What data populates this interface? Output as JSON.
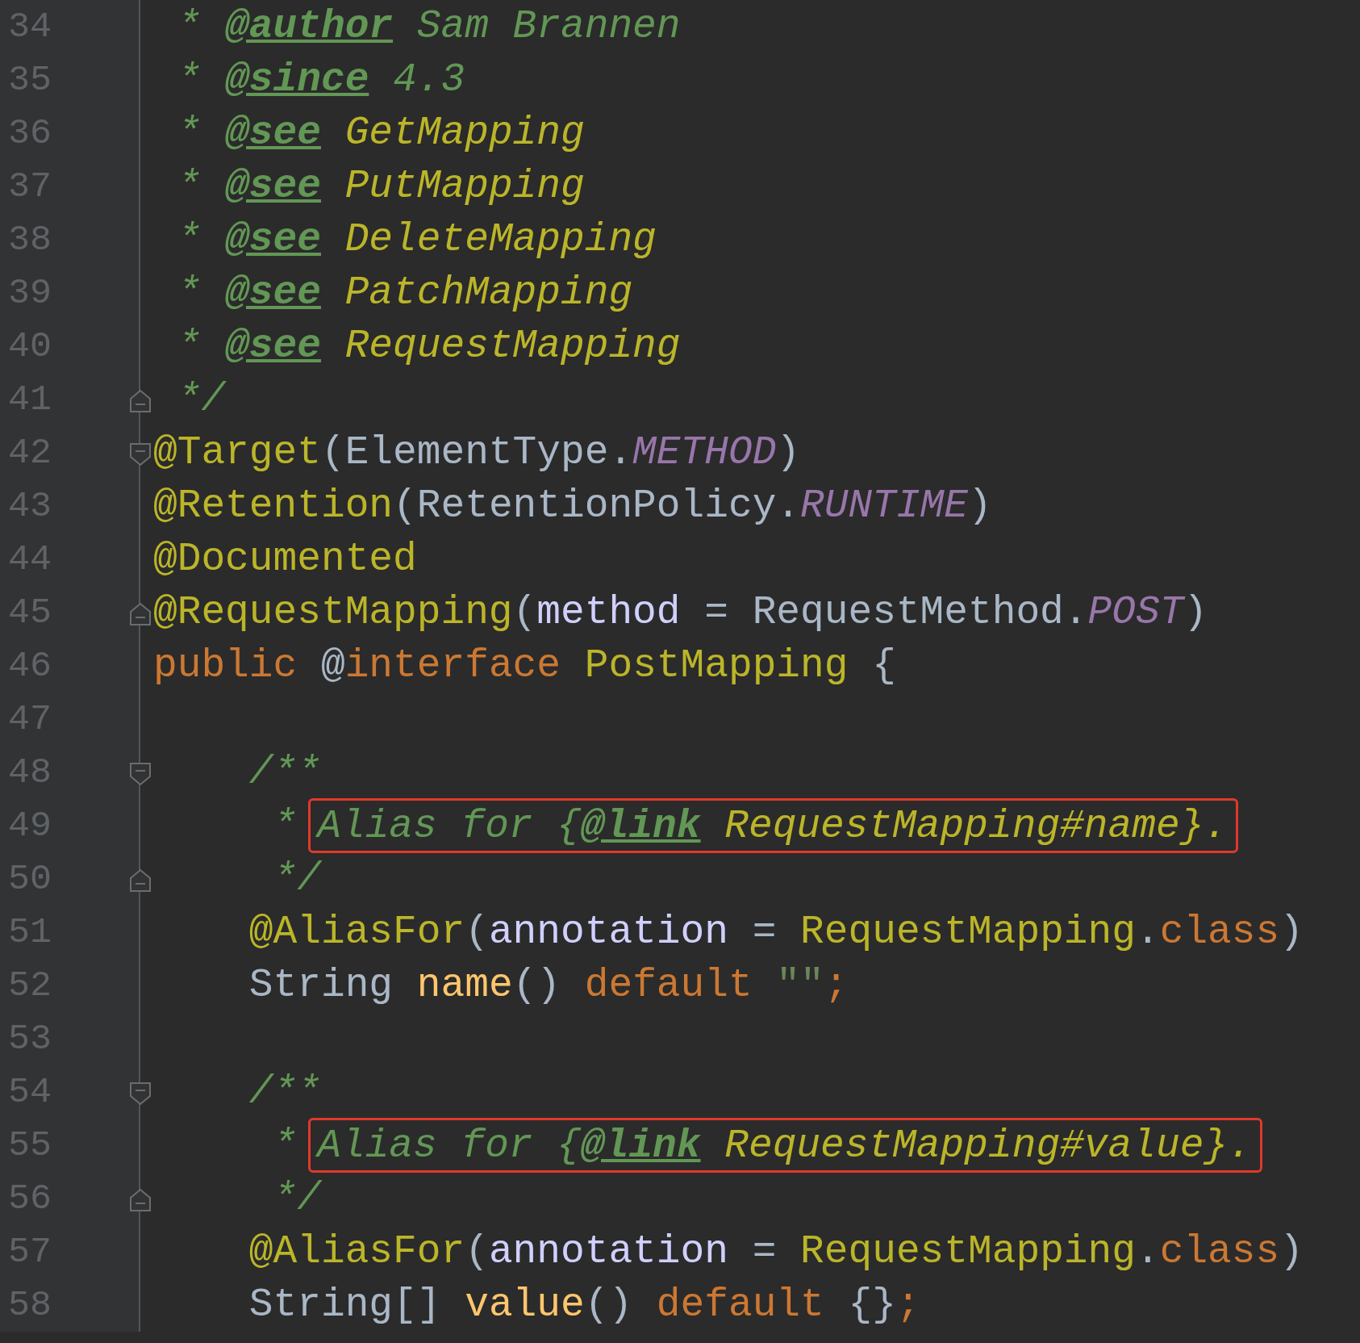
{
  "editor": {
    "lines": [
      {
        "number": "34",
        "fold_start": false,
        "fold_end": false,
        "tokens": [
          {
            "kind": "comment",
            "text": " * "
          },
          {
            "kind": "doc_tag",
            "text": "@author"
          },
          {
            "kind": "comment",
            "text": " Sam Brannen"
          }
        ]
      },
      {
        "number": "35",
        "fold_start": false,
        "fold_end": false,
        "tokens": [
          {
            "kind": "comment",
            "text": " * "
          },
          {
            "kind": "doc_tag",
            "text": "@since"
          },
          {
            "kind": "comment",
            "text": " 4.3"
          }
        ]
      },
      {
        "number": "36",
        "fold_start": false,
        "fold_end": false,
        "tokens": [
          {
            "kind": "comment",
            "text": " * "
          },
          {
            "kind": "doc_tag",
            "text": "@see"
          },
          {
            "kind": "doc_ref",
            "text": " GetMapping"
          }
        ]
      },
      {
        "number": "37",
        "fold_start": false,
        "fold_end": false,
        "tokens": [
          {
            "kind": "comment",
            "text": " * "
          },
          {
            "kind": "doc_tag",
            "text": "@see"
          },
          {
            "kind": "doc_ref",
            "text": " PutMapping"
          }
        ]
      },
      {
        "number": "38",
        "fold_start": false,
        "fold_end": false,
        "tokens": [
          {
            "kind": "comment",
            "text": " * "
          },
          {
            "kind": "doc_tag",
            "text": "@see"
          },
          {
            "kind": "doc_ref",
            "text": " DeleteMapping"
          }
        ]
      },
      {
        "number": "39",
        "fold_start": false,
        "fold_end": false,
        "tokens": [
          {
            "kind": "comment",
            "text": " * "
          },
          {
            "kind": "doc_tag",
            "text": "@see"
          },
          {
            "kind": "doc_ref",
            "text": " PatchMapping"
          }
        ]
      },
      {
        "number": "40",
        "fold_start": false,
        "fold_end": false,
        "tokens": [
          {
            "kind": "comment",
            "text": " * "
          },
          {
            "kind": "doc_tag",
            "text": "@see"
          },
          {
            "kind": "doc_ref",
            "text": " RequestMapping"
          }
        ]
      },
      {
        "number": "41",
        "fold_start": false,
        "fold_end": true,
        "tokens": [
          {
            "kind": "comment",
            "text": " */"
          }
        ]
      },
      {
        "number": "42",
        "fold_start": true,
        "fold_end": false,
        "tokens": [
          {
            "kind": "annotation",
            "text": "@Target"
          },
          {
            "kind": "plain",
            "text": "(ElementType."
          },
          {
            "kind": "constant",
            "text": "METHOD"
          },
          {
            "kind": "plain",
            "text": ")"
          }
        ]
      },
      {
        "number": "43",
        "fold_start": false,
        "fold_end": false,
        "tokens": [
          {
            "kind": "annotation",
            "text": "@Retention"
          },
          {
            "kind": "plain",
            "text": "(RetentionPolicy."
          },
          {
            "kind": "constant",
            "text": "RUNTIME"
          },
          {
            "kind": "plain",
            "text": ")"
          }
        ]
      },
      {
        "number": "44",
        "fold_start": false,
        "fold_end": false,
        "tokens": [
          {
            "kind": "annotation",
            "text": "@Documented"
          }
        ]
      },
      {
        "number": "45",
        "fold_start": false,
        "fold_end": true,
        "tokens": [
          {
            "kind": "annotation",
            "text": "@RequestMapping"
          },
          {
            "kind": "plain",
            "text": "("
          },
          {
            "kind": "param",
            "text": "method"
          },
          {
            "kind": "plain",
            "text": " = RequestMethod."
          },
          {
            "kind": "constant",
            "text": "POST"
          },
          {
            "kind": "plain",
            "text": ")"
          }
        ]
      },
      {
        "number": "46",
        "fold_start": false,
        "fold_end": false,
        "tokens": [
          {
            "kind": "keyword",
            "text": "public "
          },
          {
            "kind": "plain",
            "text": "@"
          },
          {
            "kind": "keyword",
            "text": "interface "
          },
          {
            "kind": "annotation",
            "text": "PostMapping"
          },
          {
            "kind": "plain",
            "text": " {"
          }
        ]
      },
      {
        "number": "47",
        "fold_start": false,
        "fold_end": false
      },
      {
        "number": "48",
        "fold_start": true,
        "fold_end": false,
        "tokens": [
          {
            "kind": "comment",
            "text": "    /**"
          }
        ]
      },
      {
        "number": "49",
        "fold_start": false,
        "fold_end": false,
        "tokens": [
          {
            "kind": "comment",
            "text": "     *"
          }
        ],
        "boxed_tokens": [
          {
            "kind": "comment",
            "text": "Alias for {"
          },
          {
            "kind": "doc_tag",
            "text": "@link"
          },
          {
            "kind": "doc_ref",
            "text": " RequestMapping#name}."
          }
        ]
      },
      {
        "number": "50",
        "fold_start": false,
        "fold_end": true,
        "tokens": [
          {
            "kind": "comment",
            "text": "     */"
          }
        ]
      },
      {
        "number": "51",
        "fold_start": false,
        "fold_end": false,
        "tokens": [
          {
            "kind": "annotation",
            "text": "    @AliasFor"
          },
          {
            "kind": "plain",
            "text": "("
          },
          {
            "kind": "param",
            "text": "annotation"
          },
          {
            "kind": "plain",
            "text": " = "
          },
          {
            "kind": "annotation",
            "text": "RequestMapping"
          },
          {
            "kind": "plain",
            "text": "."
          },
          {
            "kind": "keyword",
            "text": "class"
          },
          {
            "kind": "plain",
            "text": ")"
          }
        ]
      },
      {
        "number": "52",
        "fold_start": false,
        "fold_end": false,
        "tokens": [
          {
            "kind": "plain",
            "text": "    String "
          },
          {
            "kind": "method",
            "text": "name"
          },
          {
            "kind": "plain",
            "text": "() "
          },
          {
            "kind": "keyword",
            "text": "default "
          },
          {
            "kind": "string",
            "text": "\"\""
          },
          {
            "kind": "keyword",
            "text": ";"
          }
        ]
      },
      {
        "number": "53",
        "fold_start": false,
        "fold_end": false
      },
      {
        "number": "54",
        "fold_start": true,
        "fold_end": false,
        "tokens": [
          {
            "kind": "comment",
            "text": "    /**"
          }
        ]
      },
      {
        "number": "55",
        "fold_start": false,
        "fold_end": false,
        "tokens": [
          {
            "kind": "comment",
            "text": "     *"
          }
        ],
        "boxed_tokens": [
          {
            "kind": "comment",
            "text": "Alias for {"
          },
          {
            "kind": "doc_tag",
            "text": "@link"
          },
          {
            "kind": "doc_ref",
            "text": " RequestMapping#value}."
          }
        ]
      },
      {
        "number": "56",
        "fold_start": false,
        "fold_end": true,
        "tokens": [
          {
            "kind": "comment",
            "text": "     */"
          }
        ]
      },
      {
        "number": "57",
        "fold_start": false,
        "fold_end": false,
        "tokens": [
          {
            "kind": "annotation",
            "text": "    @AliasFor"
          },
          {
            "kind": "plain",
            "text": "("
          },
          {
            "kind": "param",
            "text": "annotation"
          },
          {
            "kind": "plain",
            "text": " = "
          },
          {
            "kind": "annotation",
            "text": "RequestMapping"
          },
          {
            "kind": "plain",
            "text": "."
          },
          {
            "kind": "keyword",
            "text": "class"
          },
          {
            "kind": "plain",
            "text": ")"
          }
        ]
      },
      {
        "number": "58",
        "fold_start": false,
        "fold_end": false,
        "tokens": [
          {
            "kind": "plain",
            "text": "    String[] "
          },
          {
            "kind": "method",
            "text": "value"
          },
          {
            "kind": "plain",
            "text": "() "
          },
          {
            "kind": "keyword",
            "text": "default "
          },
          {
            "kind": "plain",
            "text": "{}"
          },
          {
            "kind": "keyword",
            "text": ";"
          }
        ]
      }
    ]
  }
}
